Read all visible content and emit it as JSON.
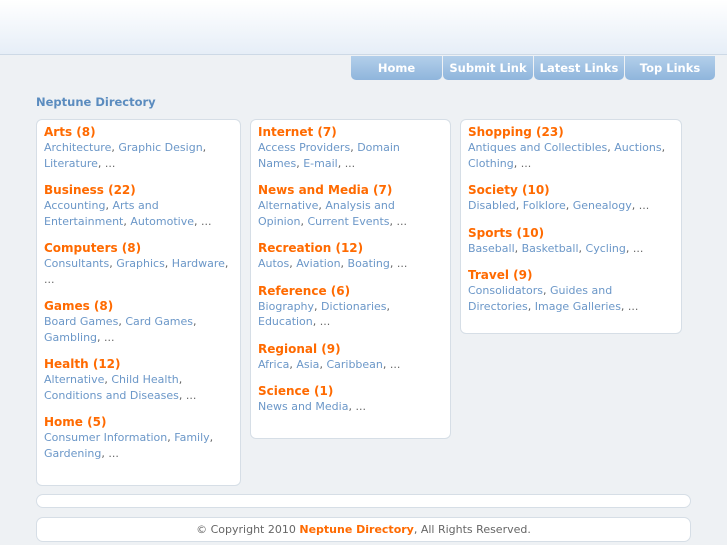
{
  "nav": [
    "Home",
    "Submit Link",
    "Latest Links",
    "Top Links"
  ],
  "site_title": "Neptune Directory",
  "columns": [
    [
      {
        "title": "Arts (8)",
        "subs": [
          "Architecture",
          "Graphic Design",
          "Literature"
        ]
      },
      {
        "title": "Business (22)",
        "subs": [
          "Accounting",
          "Arts and Entertainment",
          "Automotive"
        ]
      },
      {
        "title": "Computers (8)",
        "subs": [
          "Consultants",
          "Graphics",
          "Hardware"
        ]
      },
      {
        "title": "Games (8)",
        "subs": [
          "Board Games",
          "Card Games",
          "Gambling"
        ]
      },
      {
        "title": "Health (12)",
        "subs": [
          "Alternative",
          "Child Health",
          "Conditions and Diseases"
        ]
      },
      {
        "title": "Home (5)",
        "subs": [
          "Consumer Information",
          "Family",
          "Gardening"
        ]
      }
    ],
    [
      {
        "title": "Internet (7)",
        "subs": [
          "Access Providers",
          "Domain Names",
          "E-mail"
        ]
      },
      {
        "title": "News and Media (7)",
        "subs": [
          "Alternative",
          "Analysis and Opinion",
          "Current Events"
        ]
      },
      {
        "title": "Recreation (12)",
        "subs": [
          "Autos",
          "Aviation",
          "Boating"
        ]
      },
      {
        "title": "Reference (6)",
        "subs": [
          "Biography",
          "Dictionaries",
          "Education"
        ]
      },
      {
        "title": "Regional (9)",
        "subs": [
          "Africa",
          "Asia",
          "Caribbean"
        ]
      },
      {
        "title": "Science (1)",
        "subs": [
          "News and Media"
        ]
      }
    ],
    [
      {
        "title": "Shopping (23)",
        "subs": [
          "Antiques and Collectibles",
          "Auctions",
          "Clothing"
        ]
      },
      {
        "title": "Society (10)",
        "subs": [
          "Disabled",
          "Folklore",
          "Genealogy"
        ]
      },
      {
        "title": "Sports (10)",
        "subs": [
          "Baseball",
          "Basketball",
          "Cycling"
        ]
      },
      {
        "title": "Travel (9)",
        "subs": [
          "Consolidators",
          "Guides and Directories",
          "Image Galleries"
        ]
      }
    ]
  ],
  "separator": ",",
  "ellipsis": "...",
  "footer": {
    "prefix": "© Copyright 2010",
    "brand": "Neptune Directory",
    "suffix": ", All Rights Reserved."
  },
  "colors": {
    "category": "#ff6a00",
    "link": "#6b97c8",
    "title": "#5b8cbf",
    "nav_tab": "#9fc1e3"
  }
}
